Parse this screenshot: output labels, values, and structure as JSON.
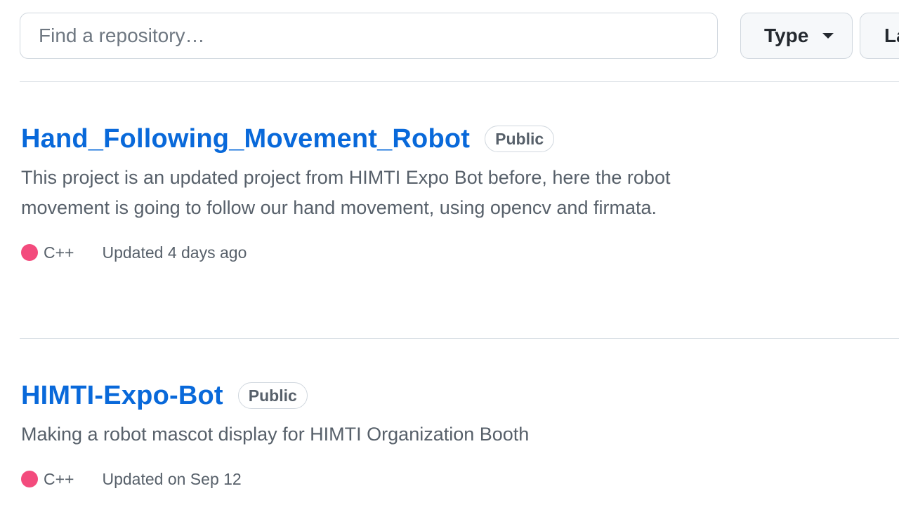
{
  "search": {
    "placeholder": "Find a repository…",
    "value": ""
  },
  "filters": {
    "type_label": "Type",
    "language_label": "Language"
  },
  "repositories": [
    {
      "name": "Hand_Following_Movement_Robot",
      "visibility": "Public",
      "description": "This project is an updated project from HIMTI Expo Bot before, here the robot movement is going to follow our hand movement, using opencv and firmata.",
      "language": "C++",
      "language_color": "#f34b7d",
      "updated": "Updated 4 days ago"
    },
    {
      "name": "HIMTI-Expo-Bot",
      "visibility": "Public",
      "description": "Making a robot mascot display for HIMTI Organization Booth",
      "language": "C++",
      "language_color": "#f34b7d",
      "updated": "Updated on Sep 12"
    }
  ],
  "colors": {
    "link": "#0969da",
    "muted_text": "#57606a",
    "border": "#d0d7de",
    "button_bg": "#f6f8fa"
  }
}
